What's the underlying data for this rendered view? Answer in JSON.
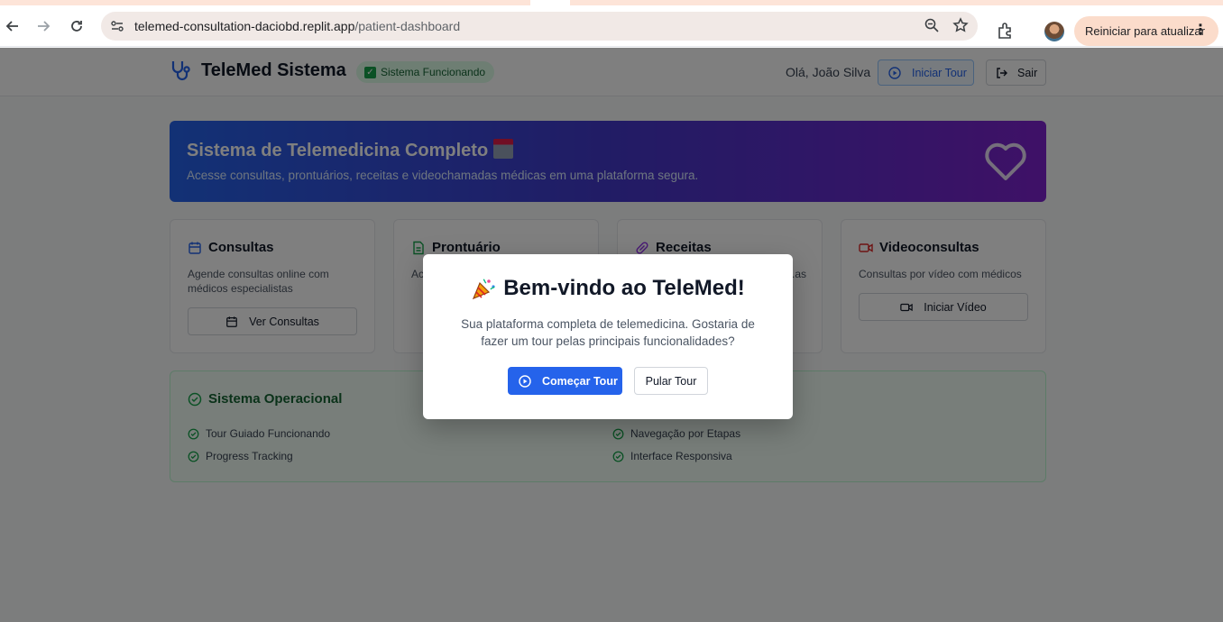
{
  "browser": {
    "url_host": "telemed-consultation-daciobd.replit.app",
    "url_path": "/patient-dashboard",
    "update_label": "Reiniciar para atualizar",
    "icons": [
      "back-arrow-icon",
      "forward-arrow-icon",
      "reload-icon",
      "site-settings-icon",
      "zoom-icon",
      "star-icon",
      "extensions-icon",
      "profile-avatar",
      "kebab-menu-icon"
    ]
  },
  "header": {
    "brand": "TeleMed Sistema",
    "status_badge": "Sistema Funcionando",
    "greeting": "Olá, João Silva",
    "tour_button": "Iniciar Tour",
    "exit_button": "Sair"
  },
  "hero": {
    "title": "Sistema de Telemedicina Completo",
    "subtitle": "Acesse consultas, prontuários, receitas e videochamadas médicas em uma plataforma segura."
  },
  "cards": [
    {
      "title": "Consultas",
      "description": "Agende consultas online com médicos especialistas",
      "button": "Ver Consultas",
      "icon": "calendar-icon"
    },
    {
      "title": "Prontuário",
      "description": "Ac...",
      "icon": "document-icon"
    },
    {
      "title": "Receitas",
      "description": "...as",
      "icon": "pill-icon"
    },
    {
      "title": "Videoconsultas",
      "description": "Consultas por vídeo com médicos",
      "button": "Iniciar Vídeo",
      "icon": "video-icon"
    }
  ],
  "system": {
    "title": "Sistema Operacional",
    "items_left": [
      "Tour Guiado Funcionando",
      "Progress Tracking"
    ],
    "items_right": [
      "Navegação por Etapas",
      "Interface Responsiva"
    ]
  },
  "modal": {
    "title": "Bem-vindo ao TeleMed!",
    "text": "Sua plataforma completa de telemedicina. Gostaria de fazer um tour pelas principais funcionalidades?",
    "start_button": "Começar Tour",
    "skip_button": "Pular Tour"
  },
  "colors": {
    "primary": "#2563eb",
    "success": "#16a34a",
    "hero_gradient": [
      "#2563eb",
      "#4338ca",
      "#7e22ce"
    ]
  }
}
